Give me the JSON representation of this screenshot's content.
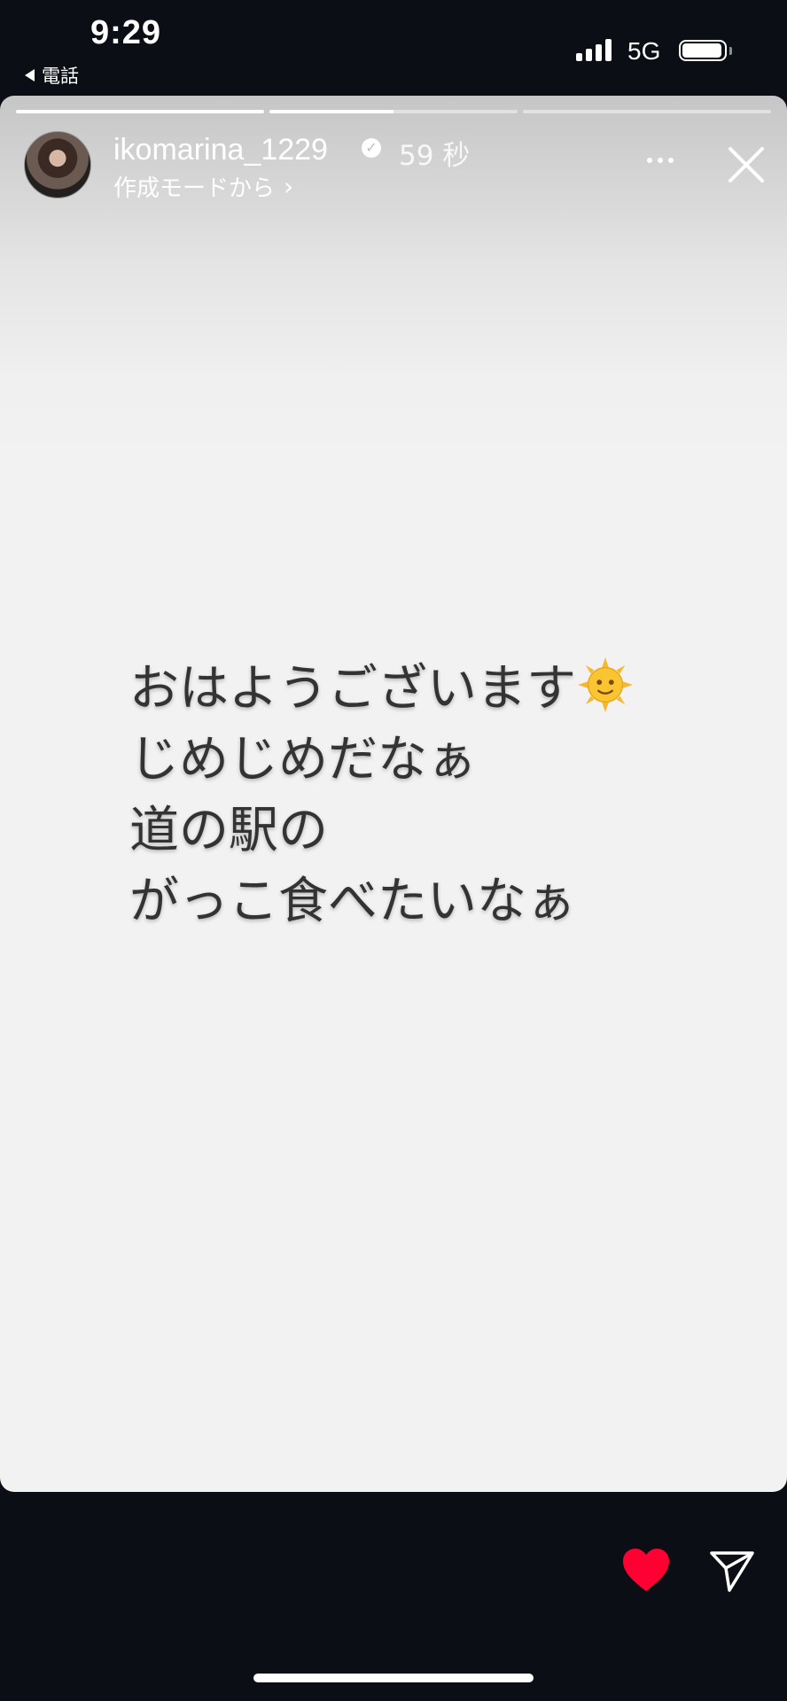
{
  "status_bar": {
    "time": "9:29",
    "back_app": "電話",
    "network": "5G",
    "battery_level": 0.95
  },
  "story": {
    "progress": [
      1.0,
      0.5,
      0.0
    ],
    "username": "ikomarina_1229",
    "verified": true,
    "time_ago": "59 秒",
    "subtitle": "作成モードから",
    "text_lines": [
      "おはようございます",
      "じめじめだなぁ",
      "道の駅の",
      "がっこ食べたいなぁ"
    ],
    "emoji": "sun-with-face-icon",
    "colors": {
      "background": "#f2f2f2",
      "text": "#333333",
      "like": "#ff0033"
    }
  },
  "actions": {
    "like": "heart-icon",
    "share": "paper-plane-icon"
  }
}
